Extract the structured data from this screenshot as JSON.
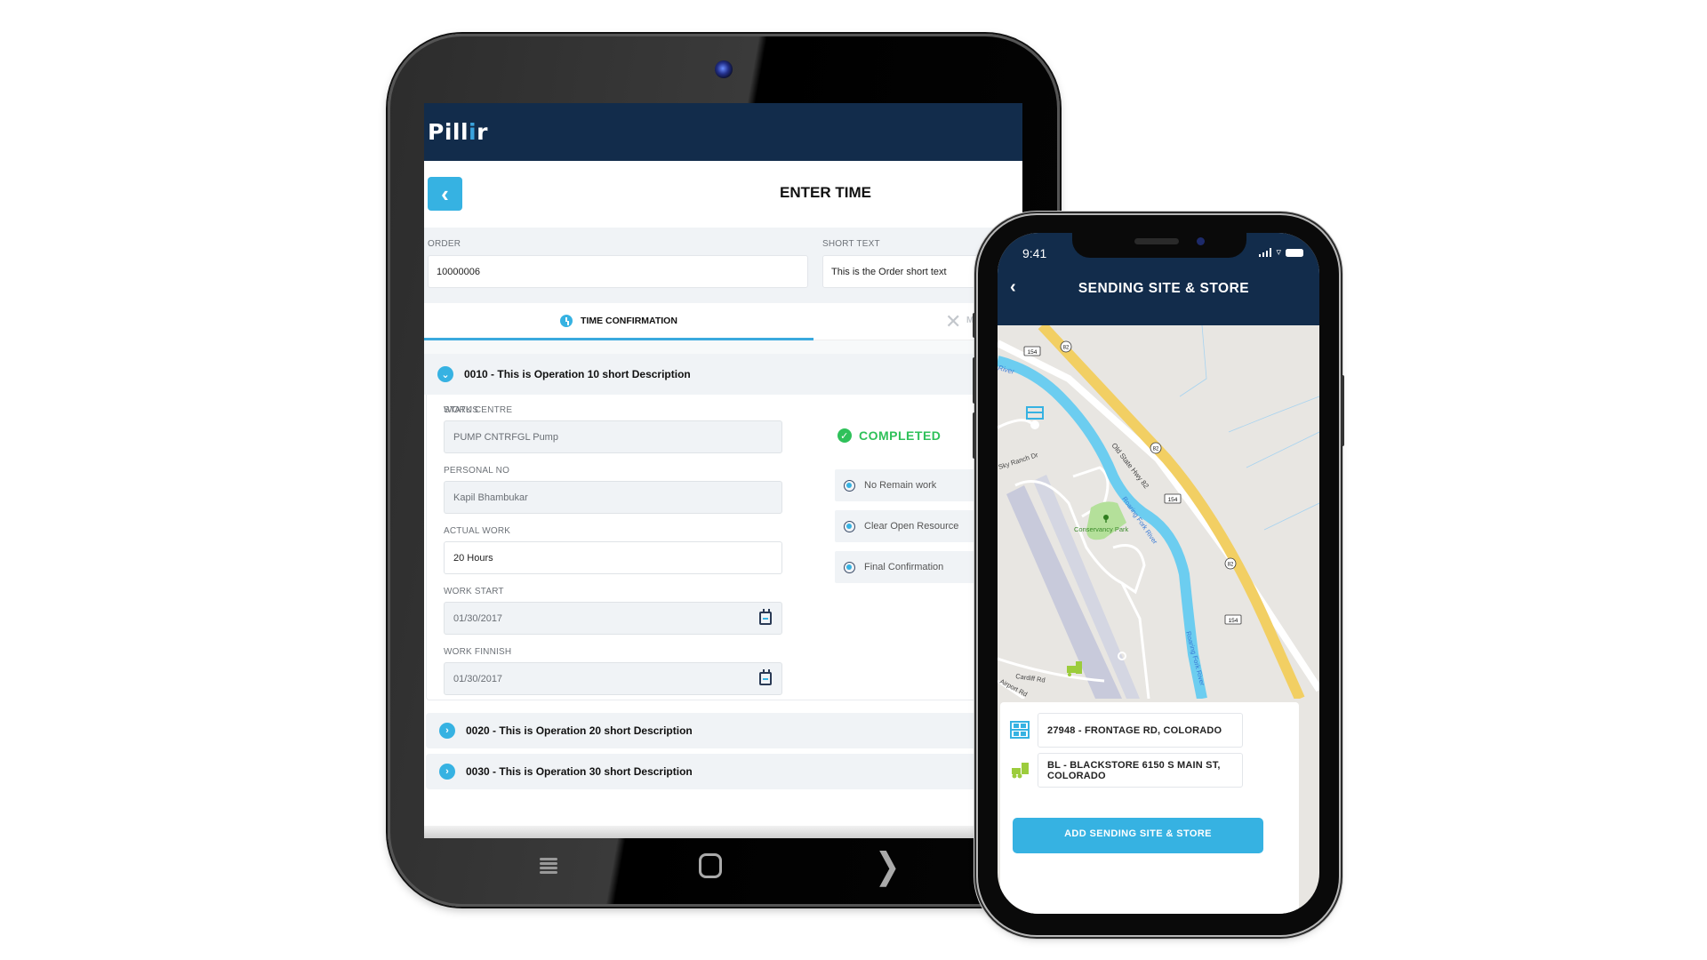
{
  "tablet": {
    "app_logo": {
      "prefix": "Pill",
      "accent": "i",
      "suffix": "r"
    },
    "page_title": "ENTER TIME",
    "back_icon": "chevron-left-icon",
    "order": {
      "label": "ORDER",
      "value": "10000006"
    },
    "short_text": {
      "label": "SHORT TEXT",
      "value": "This is the Order short text"
    },
    "tabs": [
      {
        "label": "TIME CONFIRMATION",
        "icon": "clock-icon",
        "active": true
      },
      {
        "label": "M",
        "icon": "close-icon",
        "active": false
      }
    ],
    "operations": [
      {
        "title": "0010 - This is Operation 10 short Description",
        "expanded": true,
        "fields": {
          "work_centre": {
            "label": "WORK CENTRE",
            "value": "PUMP CNTRFGL Pump"
          },
          "personal_no": {
            "label": "PERSONAL NO",
            "value": "Kapil Bhambukar"
          },
          "actual_work": {
            "label": "ACTUAL WORK",
            "value": "20 Hours"
          },
          "work_start": {
            "label": "WORK START",
            "value": "01/30/2017"
          },
          "work_finish": {
            "label": "WORK FINNISH",
            "value": "01/30/2017"
          }
        },
        "status": {
          "label": "STATUS",
          "value": "COMPLETED",
          "options": [
            "No Remain work",
            "Clear Open Resource",
            "Final Confirmation"
          ]
        }
      },
      {
        "title": "0020 - This is Operation 20 short Description",
        "expanded": false
      },
      {
        "title": "0030 - This is Operation 30 short Description",
        "expanded": false
      }
    ],
    "nav_buttons": [
      "menu",
      "home",
      "back"
    ]
  },
  "phone": {
    "status_time": "9:41",
    "title": "SENDING SITE & STORE",
    "map_labels": {
      "river": "River",
      "hwy_82": "82",
      "rd_154": "154",
      "old_state_hwy": "Old State Hwy 82",
      "roaring_fork": "Roaring Fork River",
      "sky_ranch": "Sky Ranch Dr",
      "park": "Conservancy Park",
      "cardiff": "Cardiff Rd",
      "airport": "Airport Rd"
    },
    "sending_site": "27948 - FRONTAGE RD, COLORADO",
    "store": "BL - BLACKSTORE 6150 S MAIN ST, COLORADO",
    "add_button": "ADD SENDING SITE & STORE"
  },
  "colors": {
    "navy": "#122c4b",
    "accent_blue": "#36b2e2",
    "success_green": "#2fc15a",
    "forklift_green": "#9ccc3c",
    "highway_yellow": "#f2cf63",
    "river_blue": "#6ccdf0"
  }
}
